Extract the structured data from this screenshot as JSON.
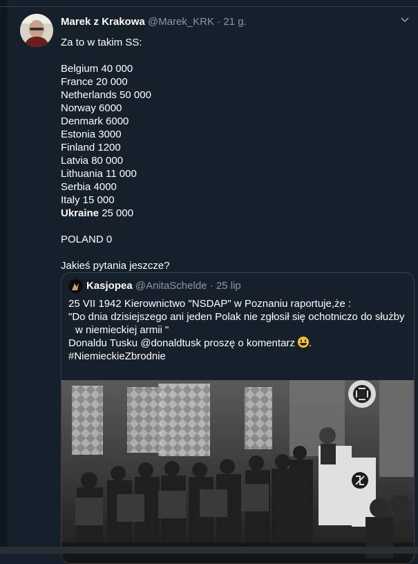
{
  "tweet": {
    "author_name": "Marek z Krakowa",
    "author_handle": "@Marek_KRK",
    "separator": "·",
    "time": "21 g.",
    "lines": [
      {
        "text": "Za to w takim SS:"
      },
      {
        "text": ""
      },
      {
        "text": "Belgium 40 000"
      },
      {
        "text": "France 20 000"
      },
      {
        "text": "Netherlands 50 000"
      },
      {
        "text": "Norway 6000"
      },
      {
        "text": "Denmark 6000"
      },
      {
        "text": "Estonia 3000"
      },
      {
        "text": "Finland 1200"
      },
      {
        "text": "Latvia 80 000"
      },
      {
        "text": "Lithuania 11 000"
      },
      {
        "text": "Serbia 4000"
      },
      {
        "text": "Italy 15 000"
      },
      {
        "bold": "Ukraine",
        "text": " 25 000"
      },
      {
        "text": ""
      },
      {
        "text": "POLAND 0"
      },
      {
        "text": ""
      },
      {
        "text": "Jakieś pytania jeszcze?"
      }
    ],
    "menu_icon": "chevron-down-icon"
  },
  "quote": {
    "author_name": "Kasjopea",
    "author_handle": "@AnitaSchelde",
    "separator": "·",
    "time": "25 lip",
    "line1": "25 VII 1942 Kierownictwo \"NSDAP\" w Poznaniu raportuje,że :",
    "line2": "\"Do dnia dzisiejszego ani jeden Polak nie zgłosił się ochotniczo do służby",
    "line3": "w niemieckiej armii \"",
    "line4_prefix": "Donaldu Tusku @donaldtusk proszę o komentarz ",
    "line4_suffix": ".",
    "line5": "#NiemieckieZbrodnie",
    "emoji_icon": "smiley-emoji-icon"
  },
  "colors": {
    "background": "#15202b",
    "muted_text": "#8899a6",
    "border": "#38444d"
  }
}
